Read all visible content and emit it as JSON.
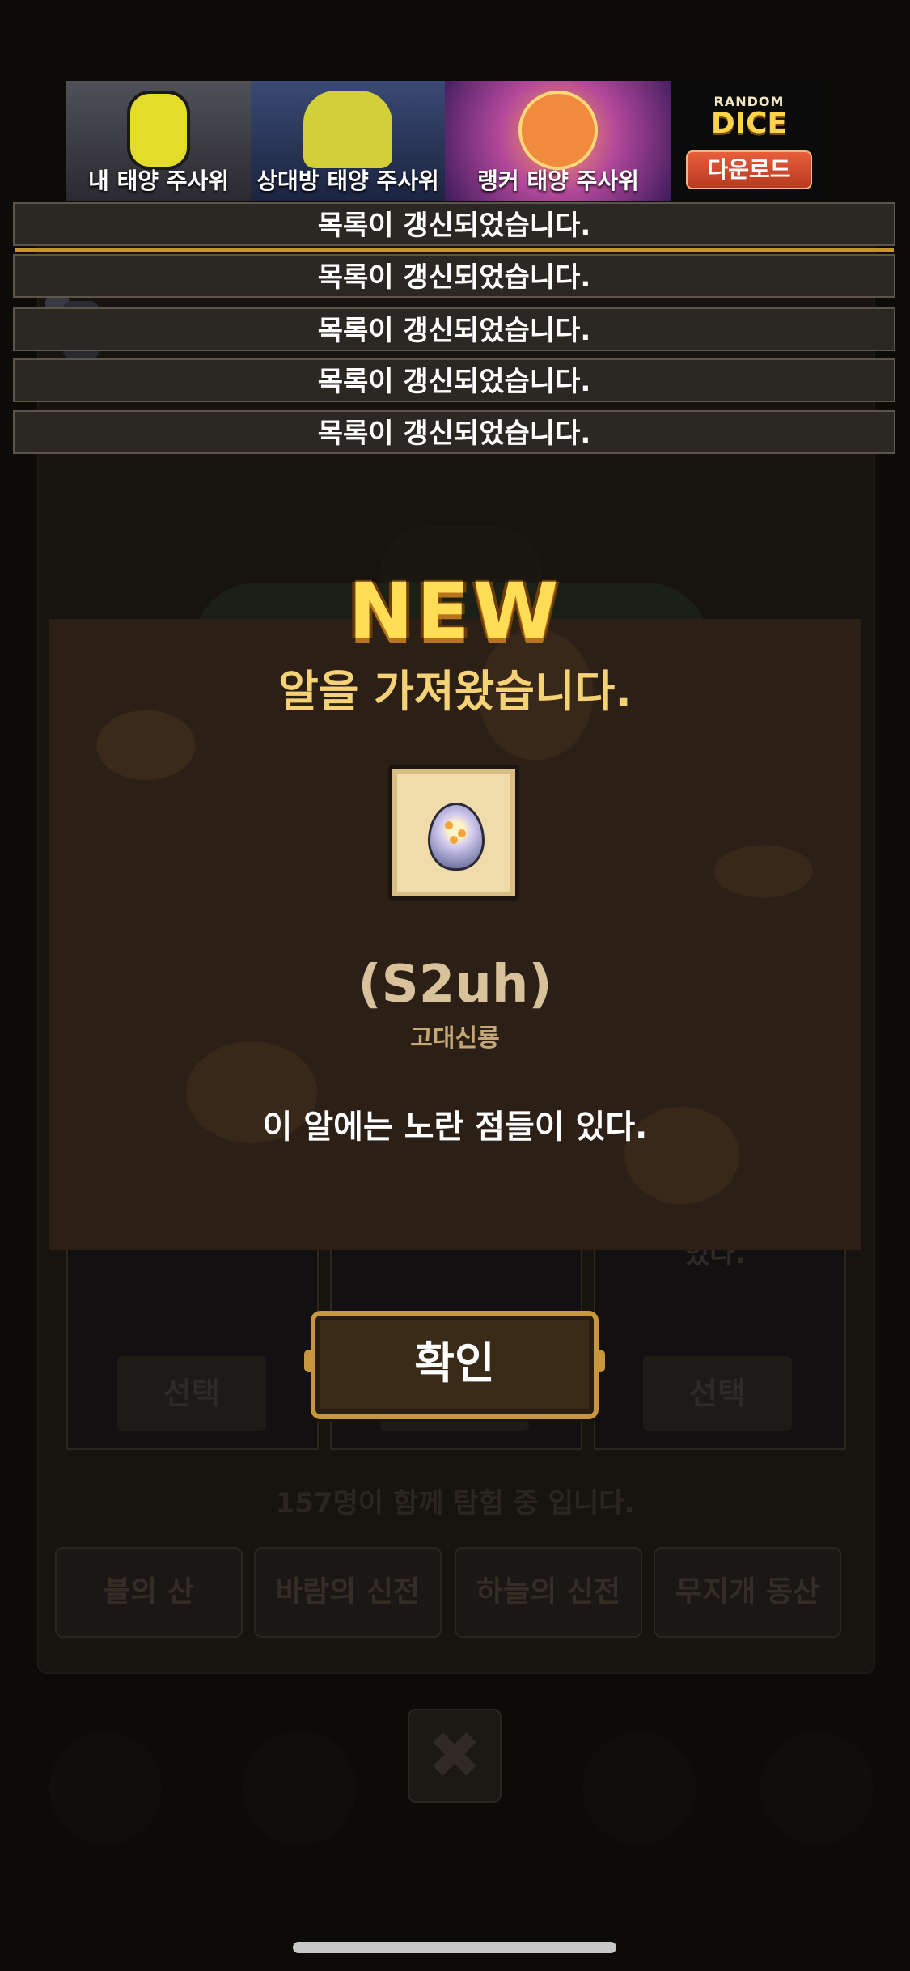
{
  "banner": {
    "tiles": [
      {
        "caption": "내 태양 주사위"
      },
      {
        "caption": "상대방 태양 주사위"
      },
      {
        "caption": "랭커 태양 주사위"
      }
    ],
    "logo_top": "RANDOM",
    "logo_main": "DICE",
    "download_label": "다운로드"
  },
  "background": {
    "select_label": "선택",
    "participants_text": "157명이 함께 탐험 중 입니다.",
    "tabs": [
      "불의 산",
      "바람의 신전",
      "하늘의 신전",
      "무지개 동산"
    ],
    "partial_text": "있다.",
    "close_glyph": "✖"
  },
  "toasts": [
    {
      "text": "목록이 갱신되었습니다."
    },
    {
      "text": "목록이 갱신되었습니다."
    },
    {
      "text": "목록이 갱신되었습니다."
    },
    {
      "text": "목록이 갱신되었습니다."
    },
    {
      "text": "목록이 갱신되었습니다."
    }
  ],
  "modal": {
    "badge": "NEW",
    "title": "알을 가져왔습니다.",
    "egg_name": "(S2uh)",
    "egg_species": "고대신룡",
    "egg_description": "이 알에는 노란 점들이 있다.",
    "confirm_label": "확인"
  },
  "colors": {
    "accent_gold": "#ffdd55",
    "title_gold": "#f6d277",
    "modal_bg": "#2b1f16",
    "button_border": "#c8963d"
  }
}
